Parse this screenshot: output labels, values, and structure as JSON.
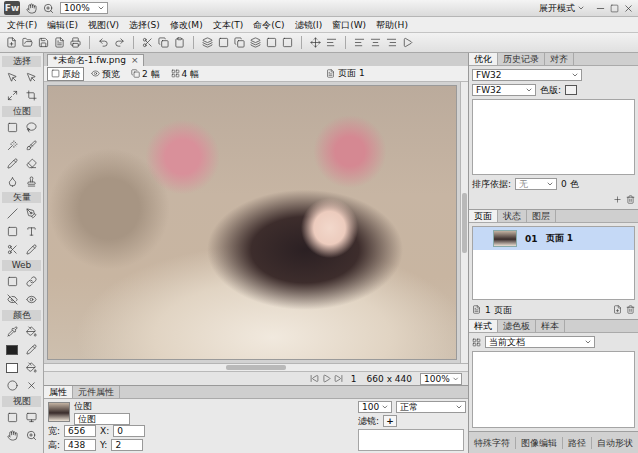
{
  "titlebar": {
    "logo": "Fw",
    "zoom": "100%",
    "mode": "展开模式"
  },
  "menu": [
    "文件(F)",
    "编辑(E)",
    "视图(V)",
    "选择(S)",
    "修改(M)",
    "文本(T)",
    "命令(C)",
    "滤镜(I)",
    "窗口(W)",
    "帮助(H)"
  ],
  "tools": {
    "sections": [
      "选择",
      "位图",
      "矢量",
      "Web",
      "颜色",
      "视图"
    ]
  },
  "document": {
    "tab": "*未命名-1.fw.png",
    "close": "×",
    "views": [
      {
        "label": "原始",
        "selected": true
      },
      {
        "label": "预览",
        "selected": false
      },
      {
        "label": "2 幅",
        "selected": false
      },
      {
        "label": "4 幅",
        "selected": false
      }
    ],
    "page": "页面 1"
  },
  "status": {
    "frame": "1",
    "size": "660 x 440",
    "zoom": "100%"
  },
  "properties": {
    "tabs": [
      {
        "label": "属性",
        "selected": true
      },
      {
        "label": "元件属性",
        "selected": false
      }
    ],
    "type": "位图",
    "name": "位图",
    "width_label": "宽:",
    "width": "656",
    "x_label": "X:",
    "x": "0",
    "height_label": "高:",
    "height": "438",
    "y_label": "Y:",
    "y": "2",
    "opacity": "100",
    "blend": "正常",
    "filters_label": "滤镜:",
    "add": "+"
  },
  "optimize_panel": {
    "tabs": [
      {
        "label": "优化",
        "selected": true
      },
      {
        "label": "历史记录",
        "selected": false
      },
      {
        "label": "对齐",
        "selected": false
      }
    ],
    "preset": "FW32",
    "format": "FW32",
    "palette_label": "色版:",
    "sort_label": "排序依据:",
    "sort": {
      "value": "无",
      "disabled": true
    },
    "colors": "0 色"
  },
  "pages_panel": {
    "tabs": [
      {
        "label": "页面",
        "selected": true
      },
      {
        "label": "状态",
        "selected": false
      },
      {
        "label": "图层",
        "selected": false
      }
    ],
    "pages": [
      {
        "number": "01",
        "name": "页面 1",
        "selected": true
      }
    ],
    "footer": "1 页面"
  },
  "styles_panel": {
    "tabs": [
      {
        "label": "样式",
        "selected": true
      },
      {
        "label": "滤色板",
        "selected": false
      },
      {
        "label": "样本",
        "selected": false
      }
    ],
    "source": "当前文档"
  },
  "bottom_tabs": [
    "特殊字符",
    "图像编辑",
    "路径",
    "自动形状"
  ]
}
